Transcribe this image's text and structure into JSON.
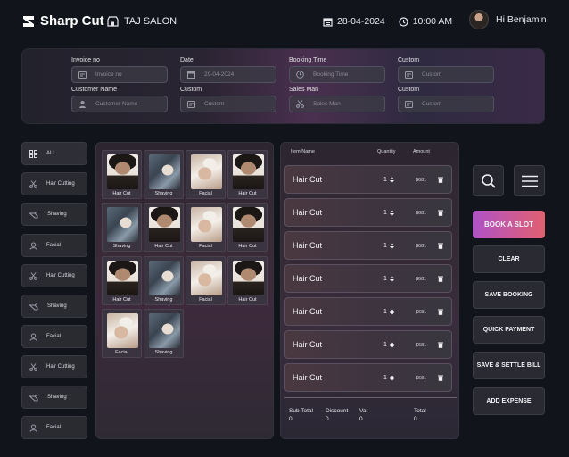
{
  "header": {
    "brand": "Sharp Cut",
    "salon": "TAJ SALON",
    "date": "28-04-2024",
    "time": "10:00 AM",
    "user_greeting": "Hi Benjamin"
  },
  "form": {
    "fields": [
      {
        "label": "Invoice no",
        "placeholder": "Invoice no",
        "icon": "id-card-icon"
      },
      {
        "label": "Date",
        "placeholder": "29-04-2024",
        "icon": "calendar-icon"
      },
      {
        "label": "Booking Time",
        "placeholder": "Booking Time",
        "icon": "clock-icon"
      },
      {
        "label": "Custom",
        "placeholder": "Custom",
        "icon": "id-card-icon"
      },
      {
        "label": "Customer Name",
        "placeholder": "Customer Name",
        "icon": "user-icon"
      },
      {
        "label": "Custom",
        "placeholder": "Custom",
        "icon": "id-card-icon"
      },
      {
        "label": "Sales Man",
        "placeholder": "Sales Man",
        "icon": "scissors-icon"
      },
      {
        "label": "Custom",
        "placeholder": "Custom",
        "icon": "id-card-icon"
      }
    ]
  },
  "categories": [
    {
      "label": "ALL",
      "icon": "grid-icon"
    },
    {
      "label": "Hair Cutting",
      "icon": "scissors-icon"
    },
    {
      "label": "Shaving",
      "icon": "razor-icon"
    },
    {
      "label": "Facial",
      "icon": "face-user-icon"
    },
    {
      "label": "Hair Cutting",
      "icon": "scissors-icon"
    },
    {
      "label": "Shaving",
      "icon": "razor-icon"
    },
    {
      "label": "Facial",
      "icon": "face-user-icon"
    },
    {
      "label": "Hair Cutting",
      "icon": "scissors-icon"
    },
    {
      "label": "Shaving",
      "icon": "razor-icon"
    },
    {
      "label": "Facial",
      "icon": "face-user-icon"
    }
  ],
  "services": [
    {
      "label": "Hair Cut",
      "kind": "haircut"
    },
    {
      "label": "Shaving",
      "kind": "shaving"
    },
    {
      "label": "Facial",
      "kind": "facial"
    },
    {
      "label": "Hair Cut",
      "kind": "haircut"
    },
    {
      "label": "Shaving",
      "kind": "shaving"
    },
    {
      "label": "Hair Cut",
      "kind": "haircut"
    },
    {
      "label": "Facial",
      "kind": "facial"
    },
    {
      "label": "Hair Cut",
      "kind": "haircut"
    },
    {
      "label": "Hair Cut",
      "kind": "haircut"
    },
    {
      "label": "Shaving",
      "kind": "shaving"
    },
    {
      "label": "Facial",
      "kind": "facial"
    },
    {
      "label": "Hair Cut",
      "kind": "haircut"
    },
    {
      "label": "Facial",
      "kind": "facial"
    },
    {
      "label": "Shaving",
      "kind": "shaving"
    }
  ],
  "order": {
    "headers": {
      "item": "Item Name",
      "quantity": "Quantity",
      "amount": "Amount"
    },
    "rows": [
      {
        "name": "Hair Cut",
        "qty": "1",
        "amount": "$681"
      },
      {
        "name": "Hair Cut",
        "qty": "1",
        "amount": "$681"
      },
      {
        "name": "Hair Cut",
        "qty": "1",
        "amount": "$681"
      },
      {
        "name": "Hair Cut",
        "qty": "1",
        "amount": "$681"
      },
      {
        "name": "Hair Cut",
        "qty": "1",
        "amount": "$681"
      },
      {
        "name": "Hair Cut",
        "qty": "1",
        "amount": "$681"
      },
      {
        "name": "Hair Cut",
        "qty": "1",
        "amount": "$681"
      }
    ],
    "totals": [
      {
        "label": "Sub Total",
        "value": "0"
      },
      {
        "label": "Discount",
        "value": "0"
      },
      {
        "label": "Vat",
        "value": "0"
      },
      {
        "label": "Total",
        "value": "0"
      }
    ]
  },
  "actions": {
    "book_slot": "BOOK A SLOT",
    "clear": "CLEAR",
    "save_booking": "SAVE BOOKING",
    "quick_payment": "QUICK PAYMENT",
    "save_settle_bill": "SAVE & SETTLE BILL",
    "add_expense": "ADD EXPENSE"
  },
  "colors": {
    "background": "#12141b",
    "accent_start": "#b052c8",
    "accent_end": "#e06070"
  }
}
